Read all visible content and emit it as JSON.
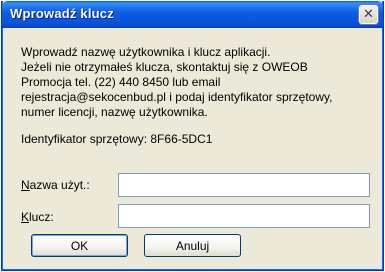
{
  "dialog": {
    "title": "Wprowadź klucz",
    "close_glyph": "✕",
    "message_lines": [
      "Wprowadź nazwę użytkownika i klucz aplikacji.",
      "Jeżeli nie otrzymałeś klucza, skontaktuj się  z OWEOB",
      "Promocja tel. (22) 440 8450 lub email",
      "rejestracja@sekocenbud.pl i podaj identyfikator sprzętowy,",
      "numer licencji, nazwę użytkownika."
    ],
    "hardware_id_text": "Identyfikator sprzętowy: 8F66-5DC1"
  },
  "form": {
    "username": {
      "label_mnemonic": "N",
      "label_rest": "azwa użyt.:",
      "value": ""
    },
    "key": {
      "label_mnemonic": "K",
      "label_rest": "lucz:",
      "value": ""
    }
  },
  "buttons": {
    "ok_label": "OK",
    "cancel_label": "Anuluj"
  },
  "colors": {
    "titlebar": "#0a50d6",
    "dialog_bg": "#ece9d8",
    "input_border": "#7f9db9"
  }
}
